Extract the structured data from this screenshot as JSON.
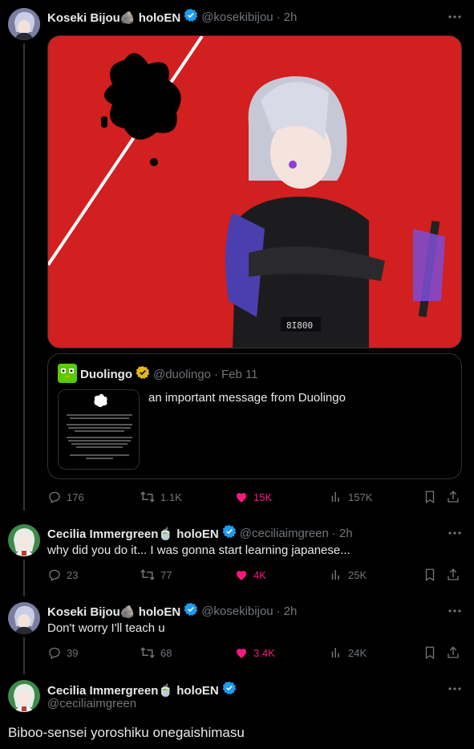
{
  "posts": [
    {
      "display_name": "Koseki Bijou🪨 holoEN",
      "handle": "@kosekibijou",
      "time": "2h",
      "quote": {
        "display_name": "Duolingo",
        "handle": "@duolingo",
        "time": "Feb 11",
        "text": "an important message from Duolingo"
      },
      "stats": {
        "replies": "176",
        "reposts": "1.1K",
        "likes": "15K",
        "views": "157K"
      }
    },
    {
      "display_name": "Cecilia Immergreen🍵 holoEN",
      "handle": "@ceciliaimgreen",
      "time": "2h",
      "text": "why did you do it... I was gonna start learning japanese...",
      "stats": {
        "replies": "23",
        "reposts": "77",
        "likes": "4K",
        "views": "25K"
      }
    },
    {
      "display_name": "Koseki Bijou🪨 holoEN",
      "handle": "@kosekibijou",
      "time": "2h",
      "text": "Don't worry I'll teach u",
      "stats": {
        "replies": "39",
        "reposts": "68",
        "likes": "3.4K",
        "views": "24K"
      }
    },
    {
      "display_name": "Cecilia Immergreen🍵 holoEN",
      "handle": "@ceciliaimgreen",
      "text": "Biboo-sensei yoroshiku onegaishimasu"
    }
  ],
  "colors": {
    "background": "#000000",
    "muted": "#71767b",
    "verified": "#1d9bf0",
    "like": "#f91880",
    "gold": "#e2b719"
  },
  "icons": [
    "reply-icon",
    "repost-icon",
    "heart-icon",
    "views-icon",
    "bookmark-icon",
    "share-icon",
    "more-icon",
    "verified-icon"
  ]
}
